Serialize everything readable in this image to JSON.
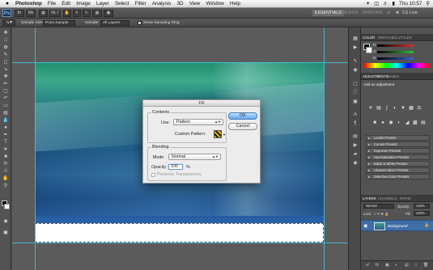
{
  "menubar": {
    "apple": "",
    "app_name": "Photoshop",
    "items": [
      "File",
      "Edit",
      "Image",
      "Layer",
      "Select",
      "Filter",
      "Analysis",
      "3D",
      "View",
      "Window",
      "Help"
    ],
    "clock": "Thu 10:57"
  },
  "appbar": {
    "logo": "Ps",
    "zoom_value": "66.7",
    "workspaces": [
      "ESSENTIALS",
      "DESIGN",
      "PAINTING"
    ],
    "more": "»",
    "cs_live": "CS Live"
  },
  "options": {
    "sample_size_label": "Sample Size:",
    "sample_size_value": "Point Sample",
    "sample_label": "Sample:",
    "sample_value": "All Layers",
    "show_ring_label": "Show Sampling Ring"
  },
  "dialog": {
    "title": "Fill",
    "contents_label": "Contents",
    "use_label": "Use:",
    "use_value": "Pattern",
    "custom_pattern_label": "Custom Pattern:",
    "blending_label": "Blending",
    "mode_label": "Mode:",
    "mode_value": "Normal",
    "opacity_label": "Opacity:",
    "opacity_value": "100",
    "opacity_unit": "%",
    "preserve_label": "Preserve Transparency",
    "ok_label": "OK",
    "cancel_label": "Cancel"
  },
  "panels": {
    "color_tabs": [
      "COLOR",
      "SWATCHES",
      "STYLES"
    ],
    "color_sliders": [
      {
        "label": "R",
        "color": "#d93030"
      },
      {
        "label": "G",
        "color": "#2fbf3a"
      },
      {
        "label": "B",
        "color": "#3a5fd8"
      }
    ],
    "adjust_tabs": [
      "ADJUSTMENTS",
      "MASKS"
    ],
    "add_adjustment": "Add an adjustment",
    "presets": [
      "Levels Presets",
      "Curves Presets",
      "Exposure Presets",
      "Hue/Saturation Presets",
      "Black & White Presets",
      "Channel Mixer Presets",
      "Selective Color Presets"
    ],
    "layers_tabs": [
      "LAYERS",
      "CHANNELS",
      "PATHS"
    ],
    "blend_mode": "Normal",
    "opacity_label": "Opacity:",
    "opacity_value": "100%",
    "lock_label": "Lock:",
    "fill_label": "Fill:",
    "fill_value": "100%",
    "layer_name": "Background"
  },
  "colors": {
    "selection_accent": "#3f6ea8",
    "guides": "#3ed0e8",
    "dialog_default_button": "#5fa8f0"
  }
}
